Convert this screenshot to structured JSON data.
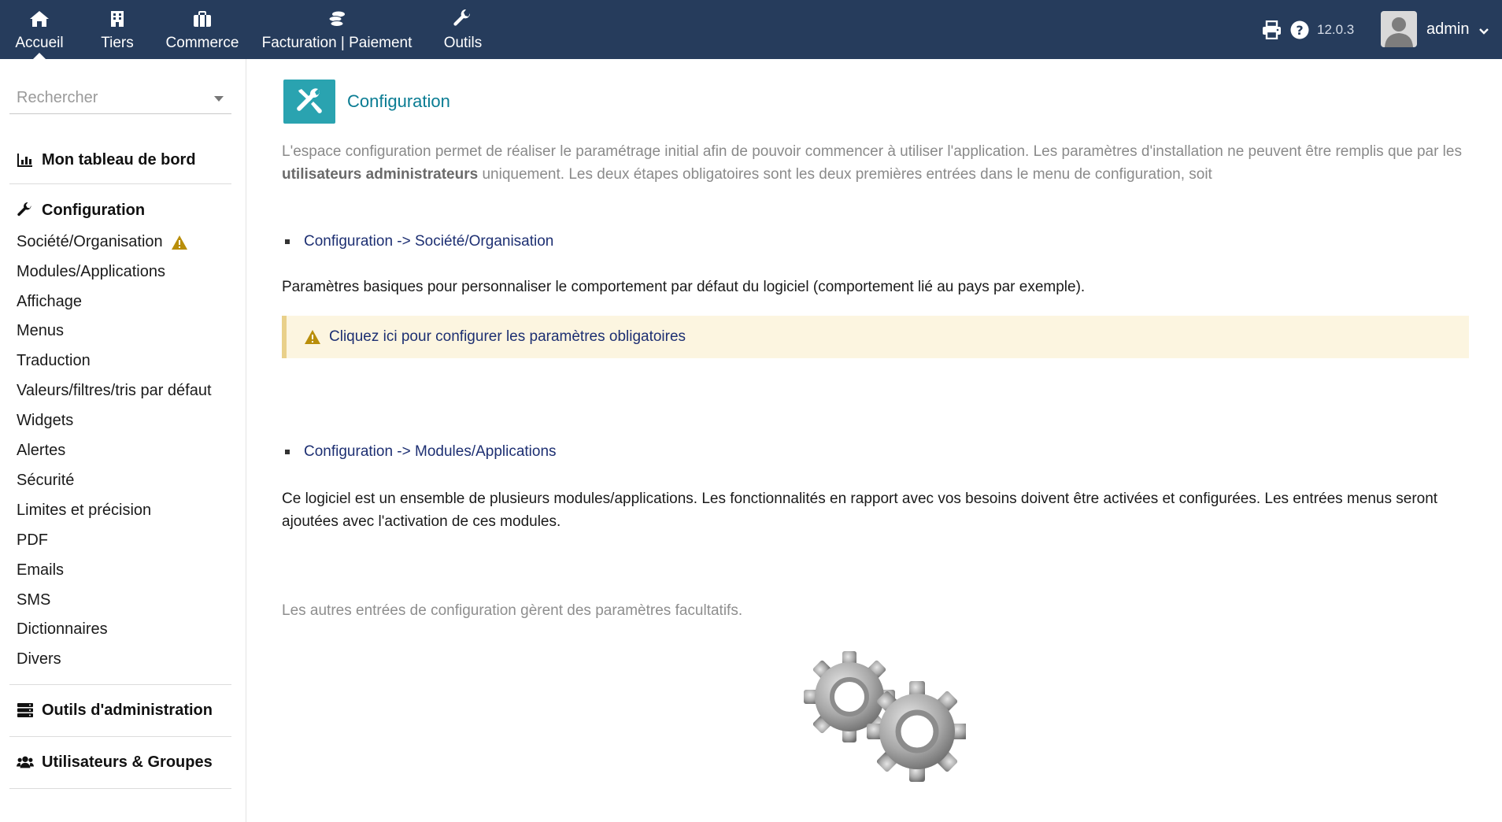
{
  "topbar": {
    "nav": [
      {
        "label": "Accueil",
        "icon": "home-icon",
        "active": true
      },
      {
        "label": "Tiers",
        "icon": "building-icon"
      },
      {
        "label": "Commerce",
        "icon": "briefcase-icon"
      },
      {
        "label": "Facturation | Paiement",
        "icon": "coins-icon"
      },
      {
        "label": "Outils",
        "icon": "wrench-icon"
      }
    ],
    "version": "12.0.3",
    "username": "admin",
    "colors": {
      "background": "#263c5c",
      "text": "#ffffff"
    }
  },
  "sidebar": {
    "search_placeholder": "Rechercher",
    "dashboard_label": "Mon tableau de bord",
    "configuration_label": "Configuration",
    "config_items": [
      {
        "label": "Société/Organisation",
        "warning": true
      },
      {
        "label": "Modules/Applications"
      },
      {
        "label": "Affichage"
      },
      {
        "label": "Menus"
      },
      {
        "label": "Traduction"
      },
      {
        "label": "Valeurs/filtres/tris par défaut"
      },
      {
        "label": "Widgets"
      },
      {
        "label": "Alertes"
      },
      {
        "label": "Sécurité"
      },
      {
        "label": "Limites et précision"
      },
      {
        "label": "PDF"
      },
      {
        "label": "Emails"
      },
      {
        "label": "SMS"
      },
      {
        "label": "Dictionnaires"
      },
      {
        "label": "Divers"
      }
    ],
    "admin_tools_label": "Outils d'administration",
    "users_groups_label": "Utilisateurs & Groupes"
  },
  "main": {
    "title": "Configuration",
    "intro_part1": "L'espace configuration permet de réaliser le paramétrage initial afin de pouvoir commencer à utiliser l'application. Les paramètres d'installation ne peuvent être remplis que par les ",
    "intro_bold": "utilisateurs administrateurs",
    "intro_part2": " uniquement. Les deux étapes obligatoires sont les deux premières entrées dans le menu de configuration, soit",
    "step1_link": "Configuration -> Société/Organisation",
    "step1_desc": "Paramètres basiques pour personnaliser le comportement par défaut du logiciel (comportement lié au pays par exemple).",
    "alert_link": "Cliquez ici pour configurer les paramètres obligatoires",
    "step2_link": "Configuration -> Modules/Applications",
    "step2_desc": "Ce logiciel est un ensemble de plusieurs modules/applications. Les fonctionnalités en rapport avec vos besoins doivent être activées et configurées. Les entrées menus seront ajoutées avec l'activation de ces modules.",
    "other_note": "Les autres entrées de configuration gèrent des paramètres facultatifs.",
    "colors": {
      "accent": "#2aa3b0",
      "link": "#1d2f72",
      "warning": "#b98e0a",
      "alert_bg": "#fcf5e0"
    }
  }
}
